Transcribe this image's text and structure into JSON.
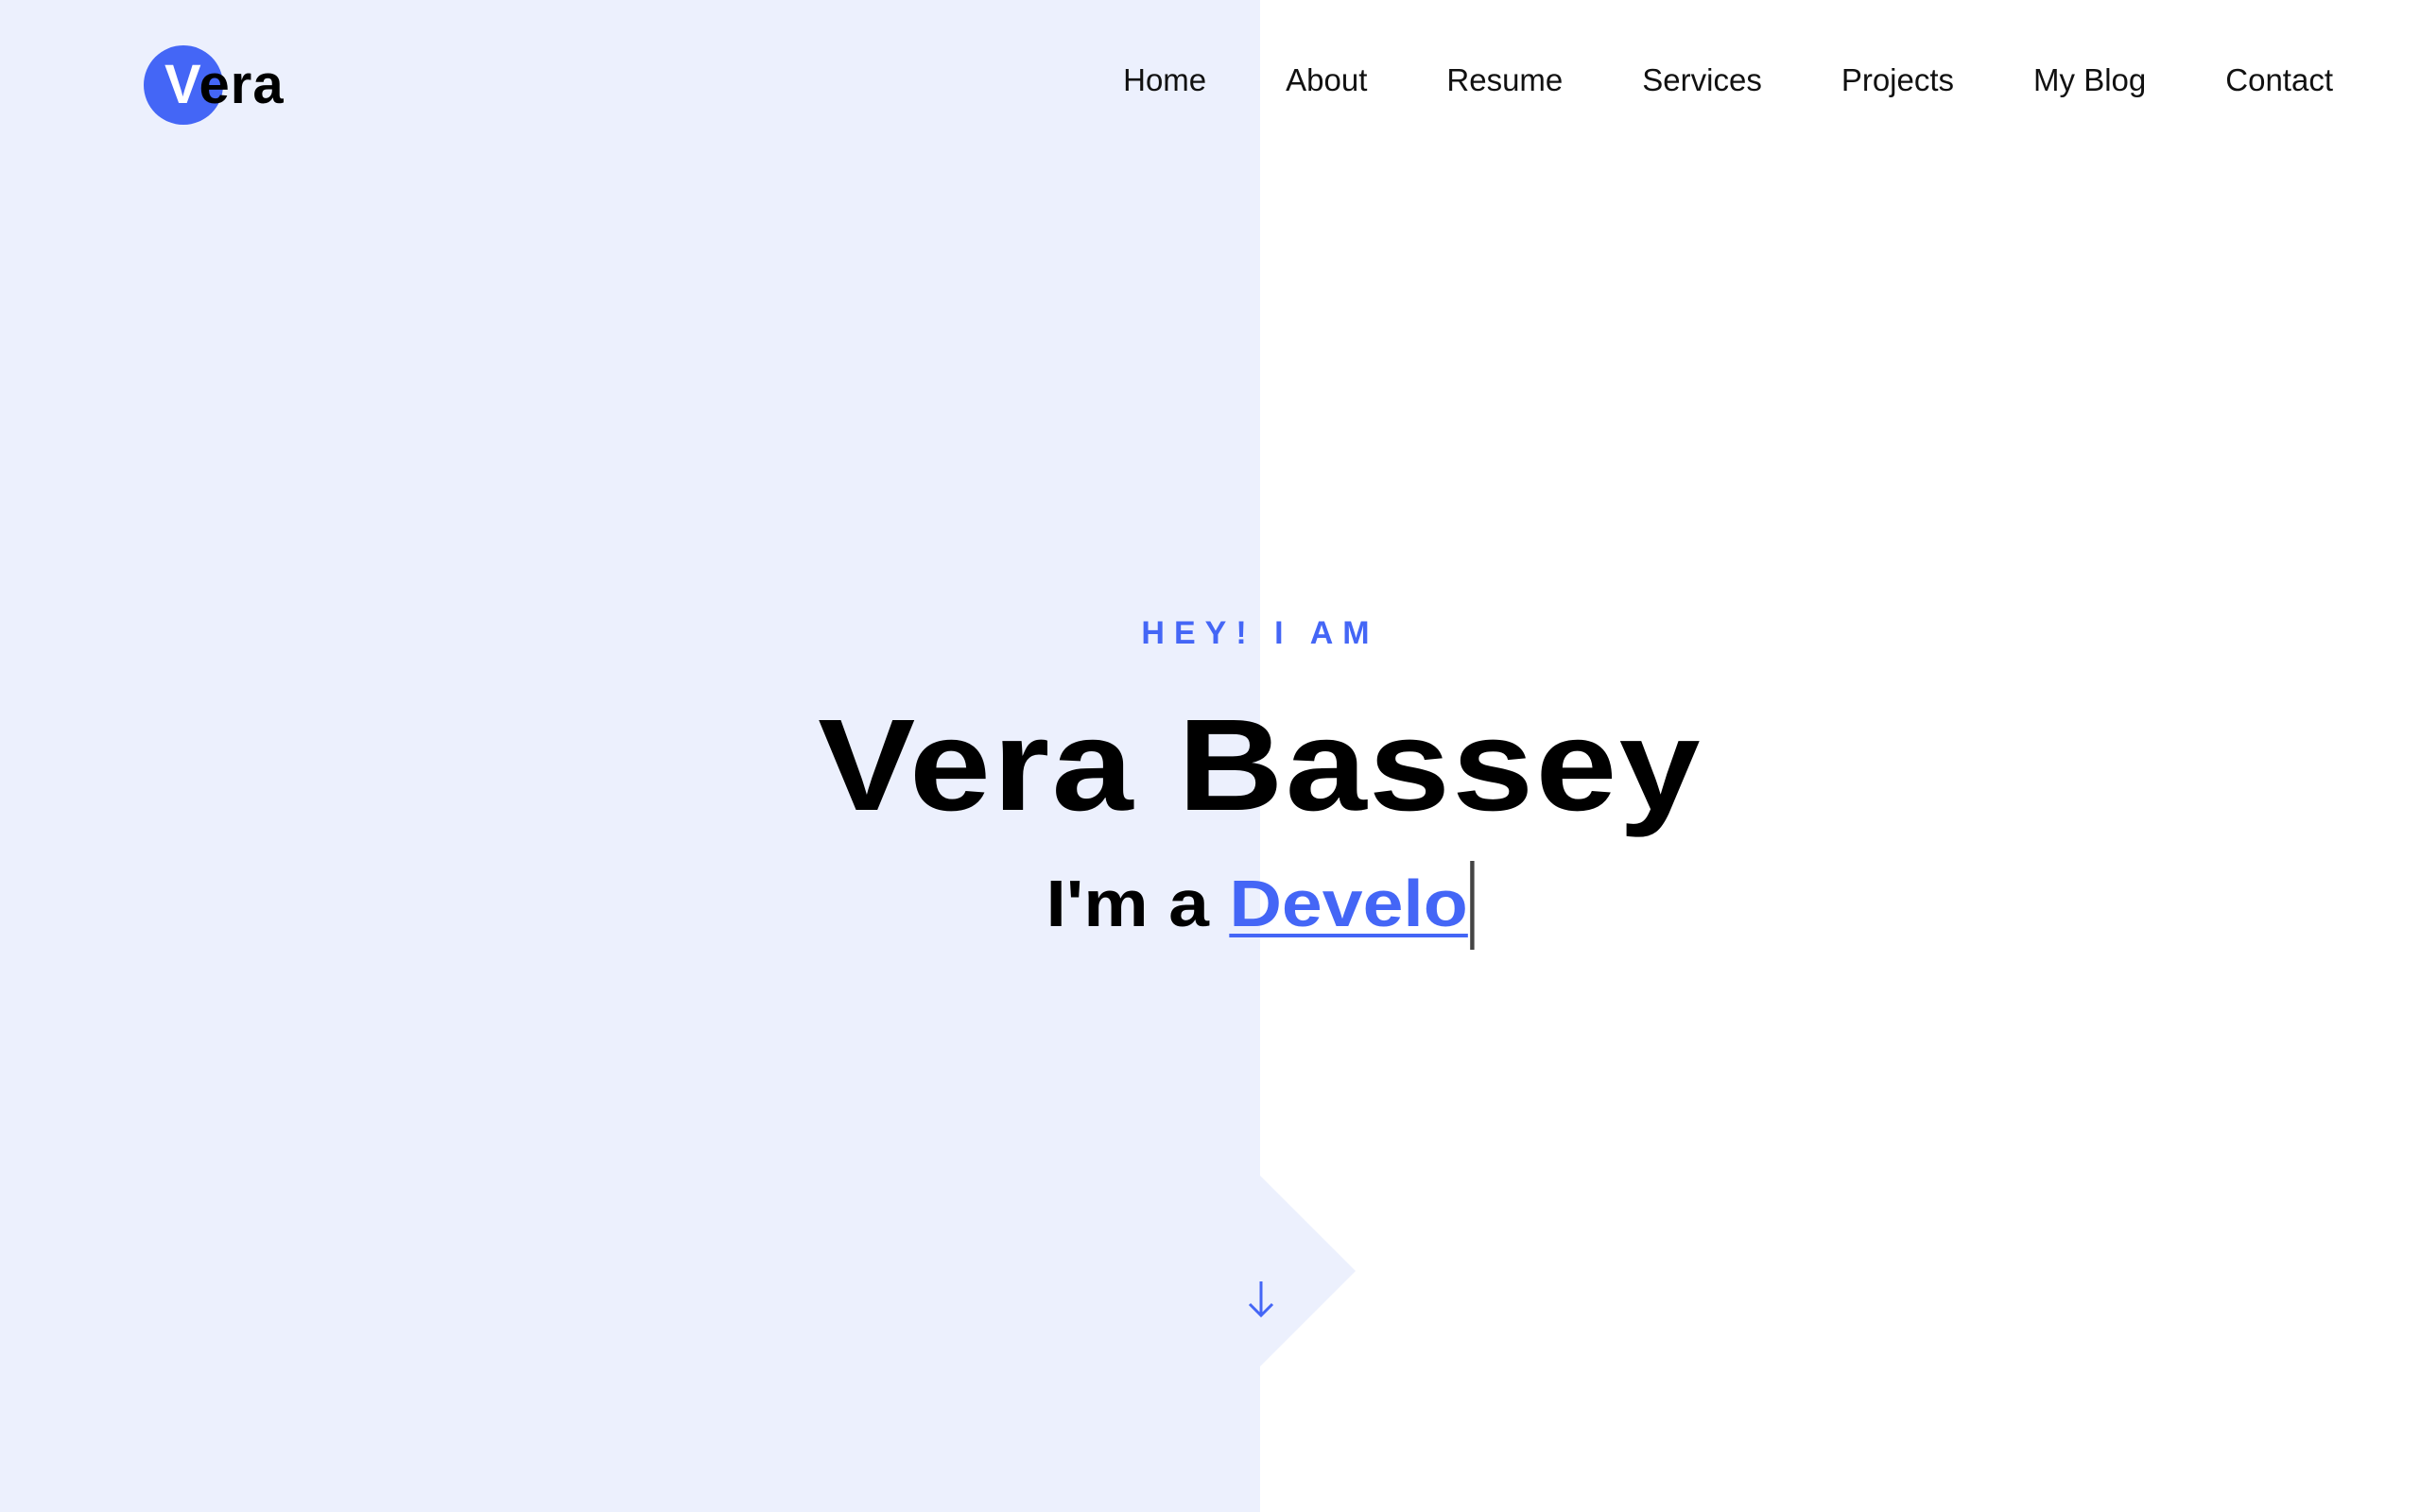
{
  "brand": {
    "initial": "V",
    "rest": "era",
    "accent_color": "#4466f6",
    "panel_color": "#ecf0fd"
  },
  "nav": {
    "items": [
      {
        "label": "Home"
      },
      {
        "label": "About"
      },
      {
        "label": "Resume"
      },
      {
        "label": "Services"
      },
      {
        "label": "Projects"
      },
      {
        "label": "My Blog"
      },
      {
        "label": "Contact"
      }
    ]
  },
  "hero": {
    "eyebrow": "HEY! I AM",
    "name": "Vera Bassey",
    "role_prefix": "I'm a ",
    "role_typed": "Develo"
  },
  "scroll": {
    "icon": "arrow-down-icon"
  }
}
